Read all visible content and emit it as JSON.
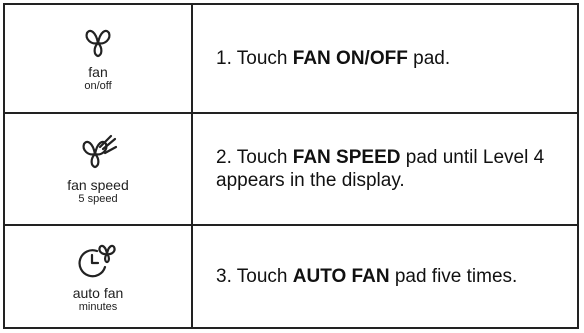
{
  "steps": [
    {
      "pad_label": "fan",
      "pad_sublabel": "on/off",
      "icon": "fan-icon",
      "number": "1.",
      "pre": "Touch ",
      "bold": "FAN ON/OFF",
      "post": " pad."
    },
    {
      "pad_label": "fan speed",
      "pad_sublabel": "5 speed",
      "icon": "fan-speed-icon",
      "number": "2.",
      "pre": "Touch ",
      "bold": "FAN SPEED",
      "post": " pad until Level 4 appears in the display."
    },
    {
      "pad_label": "auto fan",
      "pad_sublabel": "minutes",
      "icon": "auto-fan-timer-icon",
      "number": "3.",
      "pre": "Touch ",
      "bold": "AUTO FAN",
      "post": " pad five times."
    }
  ]
}
